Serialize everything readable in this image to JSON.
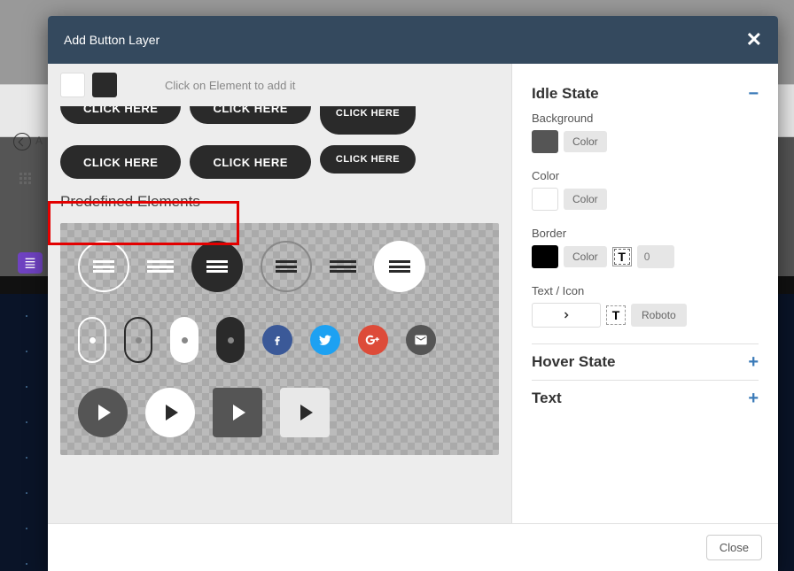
{
  "header": {
    "title": "Add Button Layer"
  },
  "toolbar": {
    "hint": "Click on Element to add it"
  },
  "buttons": {
    "row1": [
      "CLICK HERE",
      "CLICK HERE",
      "CLICK HERE"
    ],
    "row2": [
      "CLICK HERE",
      "CLICK HERE",
      "CLICK HERE"
    ]
  },
  "section_title": "Predefined Elements",
  "idle": {
    "title": "Idle State",
    "bg_label": "Background",
    "bg_pill": "Color",
    "color_label": "Color",
    "color_pill": "Color",
    "border_label": "Border",
    "border_pill": "Color",
    "border_width": "0",
    "text_label": "Text / Icon",
    "font": "Roboto"
  },
  "hover": {
    "title": "Hover State"
  },
  "text_section": {
    "title": "Text"
  },
  "footer": {
    "close": "Close"
  },
  "bg": {
    "a": "A"
  }
}
